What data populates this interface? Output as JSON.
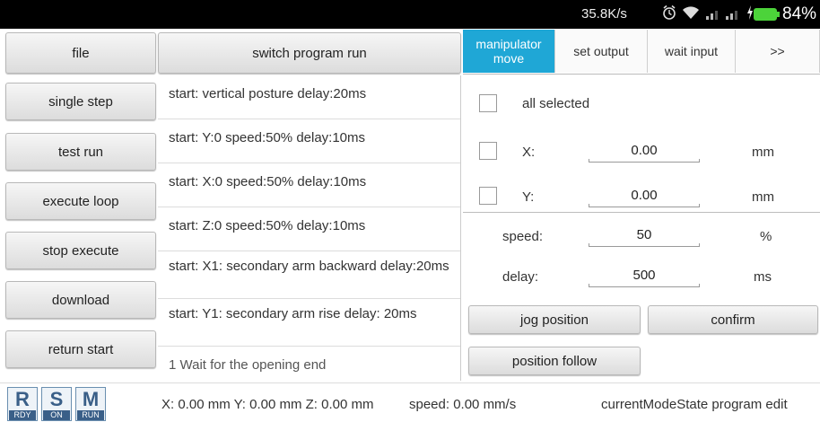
{
  "status_bar": {
    "net_speed": "35.8K/s",
    "battery": "84%",
    "icons": [
      "alarm-icon",
      "wifi-icon",
      "signal-icon",
      "signal-icon",
      "charging-icon",
      "battery-icon"
    ]
  },
  "header": {
    "file_label": "file",
    "switch_label": "switch program run"
  },
  "tabs": [
    {
      "label": "manipulator move",
      "active": true
    },
    {
      "label": "set output",
      "active": false
    },
    {
      "label": "wait input",
      "active": false
    },
    {
      "label": ">>",
      "active": false
    }
  ],
  "sidebar": {
    "buttons": [
      {
        "label": "single step"
      },
      {
        "label": "test run"
      },
      {
        "label": "execute loop"
      },
      {
        "label": "stop execute"
      },
      {
        "label": "download"
      },
      {
        "label": "return start"
      }
    ]
  },
  "program": {
    "rows": [
      "start: vertical posture   delay:20ms",
      "start: Y:0   speed:50%   delay:10ms",
      "start: X:0   speed:50%   delay:10ms",
      "start: Z:0   speed:50%   delay:10ms",
      "start: X1: secondary arm backward delay:20ms",
      "start: Y1: secondary arm rise  delay: 20ms",
      "1 Wait for the opening end"
    ]
  },
  "move_panel": {
    "all_selected_label": "all selected",
    "x_label": "X:",
    "x_value": "0.00",
    "x_unit": "mm",
    "y_label": "Y:",
    "y_value": "0.00",
    "y_unit": "mm",
    "speed_label": "speed:",
    "speed_value": "50",
    "speed_unit": "%",
    "delay_label": "delay:",
    "delay_value": "500",
    "delay_unit": "ms",
    "jog_label": "jog position",
    "confirm_label": "confirm",
    "follow_label": "position follow"
  },
  "bottom": {
    "modes": [
      {
        "letter": "R",
        "sub": "RDY"
      },
      {
        "letter": "S",
        "sub": "ON"
      },
      {
        "letter": "M",
        "sub": "RUN"
      }
    ],
    "coords": "X: 0.00 mm Y: 0.00 mm Z: 0.00 mm",
    "speed": "speed: 0.00 mm/s",
    "state": "currentModeState  program edit"
  },
  "colors": {
    "accent": "#1fa7d6",
    "status_bar": "#000000",
    "battery": "#4cd33a"
  }
}
